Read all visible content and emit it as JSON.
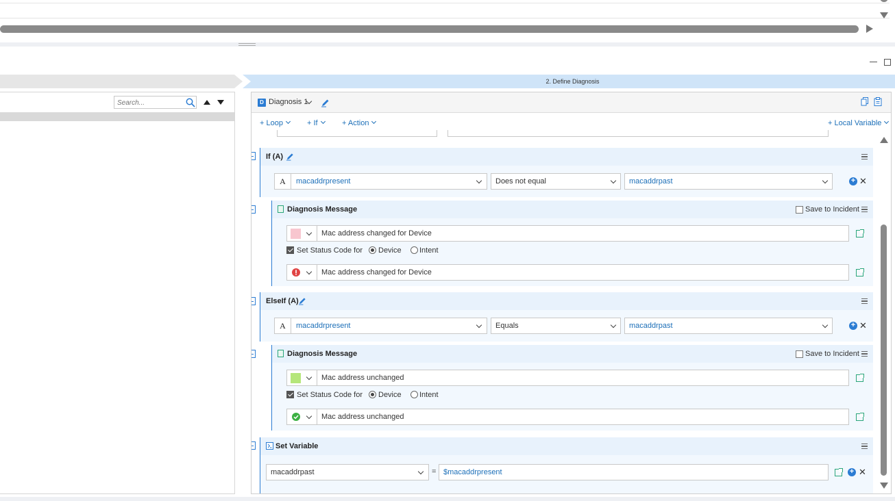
{
  "step_bar": {
    "title": "2. Define Diagnosis"
  },
  "left_panel": {
    "search_placeholder": "Search..."
  },
  "diagnosis": {
    "name": "Diagnosis 1",
    "badge": "D"
  },
  "toolbar": {
    "loop": "+ Loop",
    "if": "+ If",
    "action": "+ Action",
    "local_variable": "+ Local Variable"
  },
  "if_block": {
    "title": "If (A)",
    "type_glyph": "A",
    "left_operand": "macaddrpresent",
    "operator": "Does not equal",
    "right_operand": "macaddrpast"
  },
  "diag_message_1": {
    "title": "Diagnosis Message",
    "save_to_incident": "Save to Incident",
    "message": "Mac address changed for Device",
    "swatch_color": "#f8c6cf",
    "set_status_label": "Set Status Code for",
    "opt_device": "Device",
    "opt_intent": "Intent",
    "status_icon": "error-icon",
    "status_message": "Mac address changed for Device"
  },
  "elseif_block": {
    "title": "ElseIf (A)",
    "type_glyph": "A",
    "left_operand": "macaddrpresent",
    "operator": "Equals",
    "right_operand": "macaddrpast"
  },
  "diag_message_2": {
    "title": "Diagnosis Message",
    "save_to_incident": "Save to Incident",
    "message": "Mac address unchanged",
    "swatch_color": "#b5e67a",
    "set_status_label": "Set Status Code for",
    "opt_device": "Device",
    "opt_intent": "Intent",
    "status_icon": "success-icon",
    "status_message": "Mac address unchanged"
  },
  "set_variable": {
    "title": "Set Variable",
    "variable": "macaddrpast",
    "equals": "=",
    "value": "$macaddrpresent"
  },
  "colors": {
    "accent": "#1c6fb8",
    "block_header": "#e8f2fc",
    "step_active": "#cfe4f8",
    "error": "#e04343",
    "success": "#3cb043"
  }
}
